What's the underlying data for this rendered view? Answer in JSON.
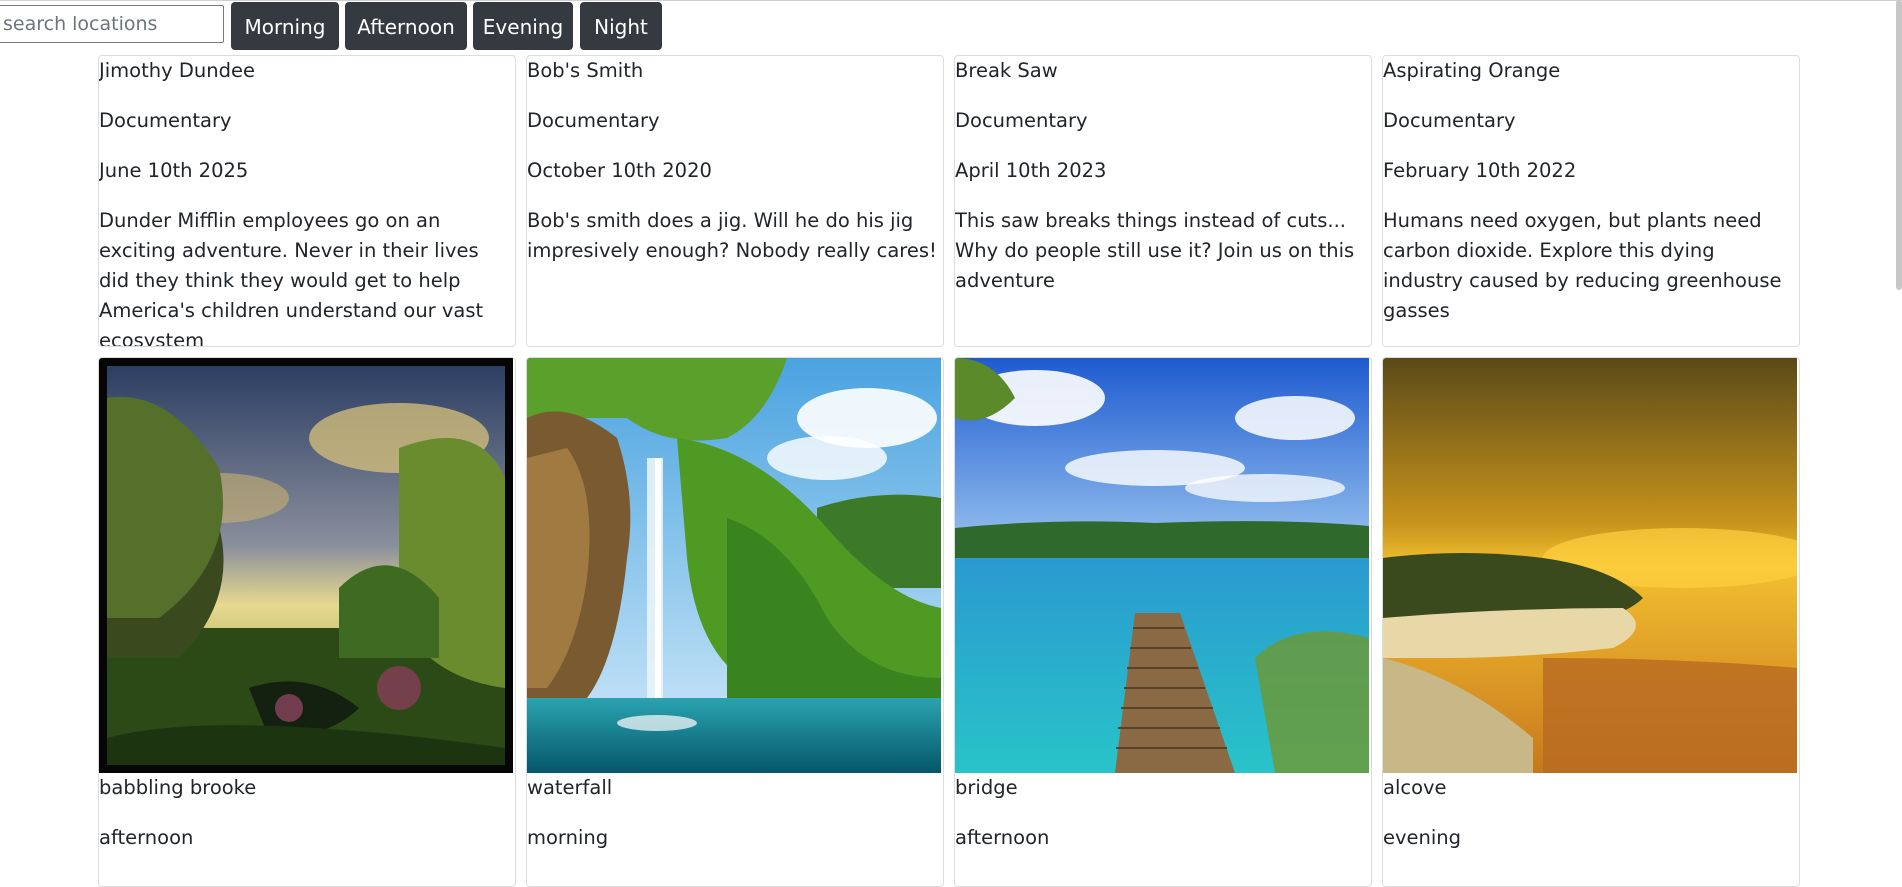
{
  "toolbar": {
    "search_placeholder": "search locations",
    "buttons": [
      "Morning",
      "Afternoon",
      "Evening",
      "Night"
    ]
  },
  "movies": [
    {
      "title": "Jimothy Dundee",
      "genre": "Documentary",
      "date": "June 10th 2025",
      "description": "Dunder Mifflin employees go on an exciting adventure. Never in their lives did they think they would get to help America's children understand our vast ecosystem"
    },
    {
      "title": "Bob's Smith",
      "genre": "Documentary",
      "date": "October 10th 2020",
      "description": "Bob's smith does a jig. Will he do his jig impresively enough? Nobody really cares!"
    },
    {
      "title": "Break Saw",
      "genre": "Documentary",
      "date": "April 10th 2023",
      "description": "This saw breaks things instead of cuts... Why do people still use it? Join us on this adventure"
    },
    {
      "title": "Aspirating Orange",
      "genre": "Documentary",
      "date": "February 10th 2022",
      "description": "Humans need oxygen, but plants need carbon dioxide. Explore this dying industry caused by reducing greenhouse gasses"
    }
  ],
  "locations": [
    {
      "name": "babbling brooke",
      "time": "afternoon"
    },
    {
      "name": "waterfall",
      "time": "morning"
    },
    {
      "name": "bridge",
      "time": "afternoon"
    },
    {
      "name": "alcove",
      "time": "evening"
    }
  ]
}
